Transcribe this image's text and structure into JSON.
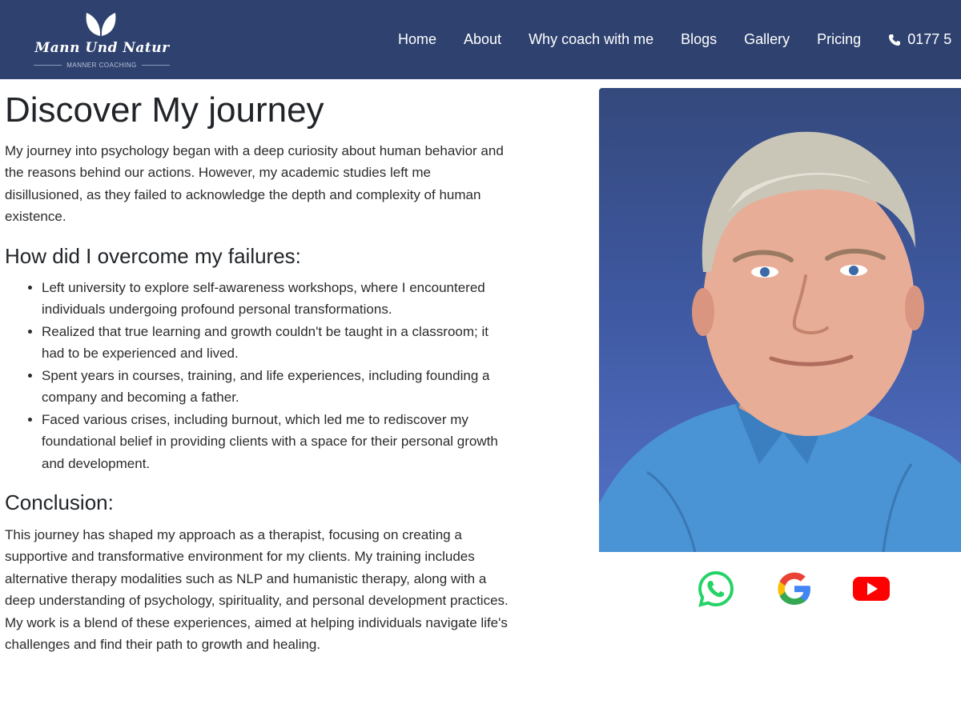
{
  "header": {
    "brand": "Mann Und Natur",
    "tagline": "MANNER COACHING",
    "nav": [
      "Home",
      "About",
      "Why coach with me",
      "Blogs",
      "Gallery",
      "Pricing"
    ],
    "phone": "0177 5",
    "bg_color": "#2f426f"
  },
  "main": {
    "title": "Discover My journey",
    "intro": "My journey into psychology began with a deep curiosity about human behavior and the reasons behind our actions. However, my academic studies left me disillusioned, as they failed to acknowledge the depth and complexity of human existence.",
    "failures_heading": "How did I overcome my failures:",
    "failures": [
      "Left university to explore self-awareness workshops, where I encountered individuals undergoing profound personal transformations.",
      "Realized that true learning and growth couldn't be taught in a classroom; it had to be experienced and lived.",
      "Spent years in courses, training, and life experiences, including founding a company and becoming a father.",
      "Faced various crises, including burnout, which led me to rediscover my foundational belief in providing clients with a space for their personal growth and development."
    ],
    "conclusion_heading": "Conclusion:",
    "conclusion": "This journey has shaped my approach as a therapist, focusing on creating a supportive and transformative environment for my clients. My training includes alternative therapy modalities such as NLP and humanistic therapy, along with a deep understanding of psychology, spirituality, and personal development practices. My work is a blend of these experiences, aimed at helping individuals navigate life's challenges and find their path to growth and healing."
  },
  "photo": {
    "icon": "portrait-photo"
  },
  "social": [
    {
      "icon": "whatsapp-icon",
      "color": "#25d366"
    },
    {
      "icon": "google-icon",
      "color": "#4285f4"
    },
    {
      "icon": "youtube-icon",
      "color": "#ff0000"
    }
  ]
}
